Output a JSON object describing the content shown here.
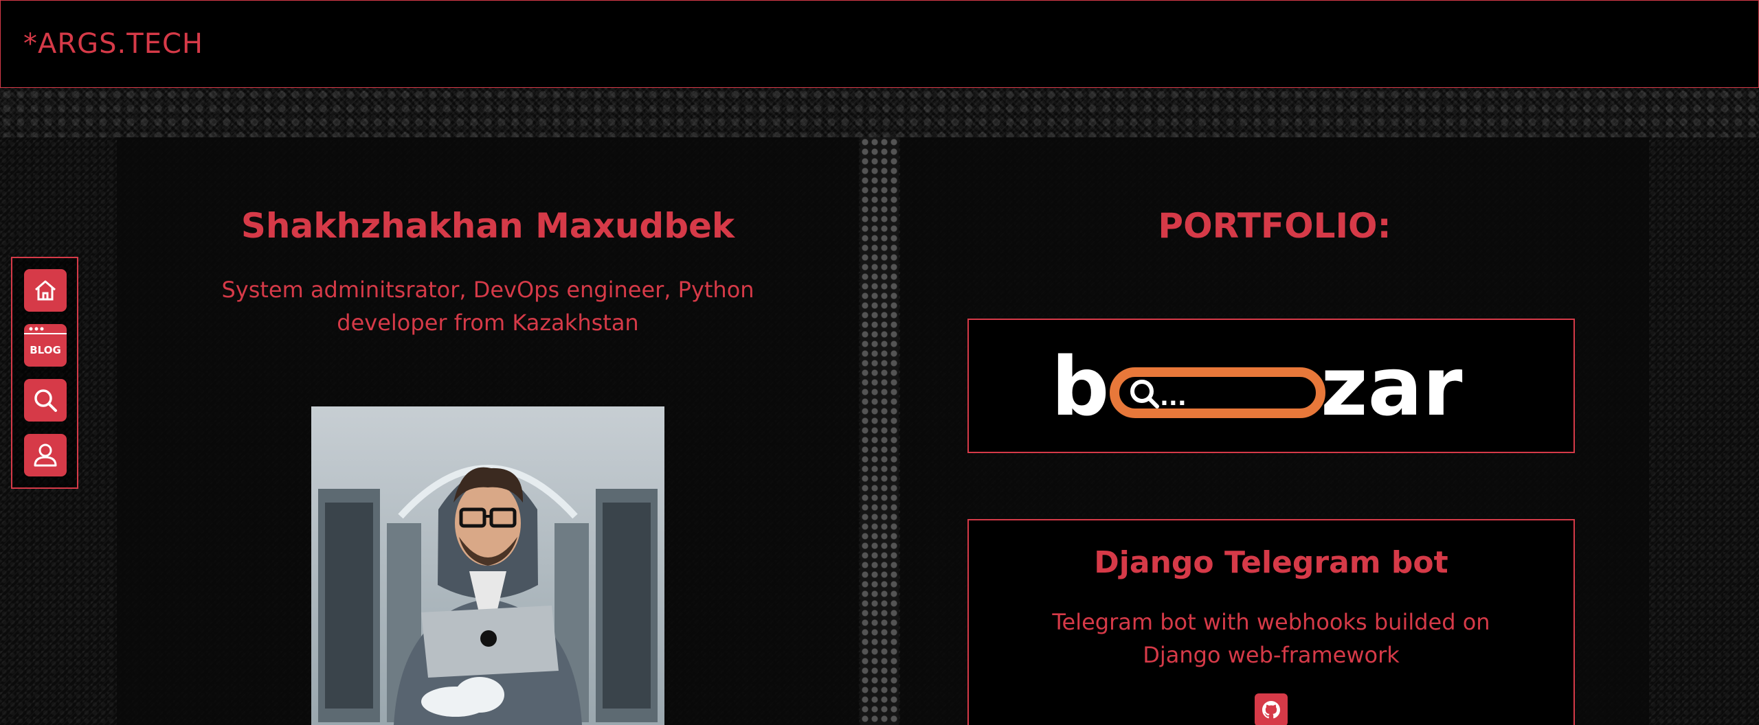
{
  "header": {
    "logo": "*ARGS.TECH"
  },
  "sidebar": {
    "items": [
      {
        "label": "Home",
        "icon": "home-icon"
      },
      {
        "label": "BLOG",
        "icon": "blog-icon"
      },
      {
        "label": "Search",
        "icon": "search-icon"
      },
      {
        "label": "Profile",
        "icon": "user-icon"
      }
    ]
  },
  "profile": {
    "name": "Shakhzhakhan Maxudbek",
    "subtitle": "System adminitsrator, DevOps engineer, Python developer from Kazakhstan"
  },
  "portfolio": {
    "title": "PORTFOLIO:",
    "projects": [
      {
        "logo_text": "bazar",
        "search_text": "Q..."
      },
      {
        "title": "Django Telegram bot",
        "description": "Telegram bot with webhooks builded on Django web-framework",
        "link_icon": "github-icon"
      }
    ]
  },
  "colors": {
    "accent": "#d63a48",
    "background": "#000000",
    "bazar_orange": "#e8783a"
  }
}
